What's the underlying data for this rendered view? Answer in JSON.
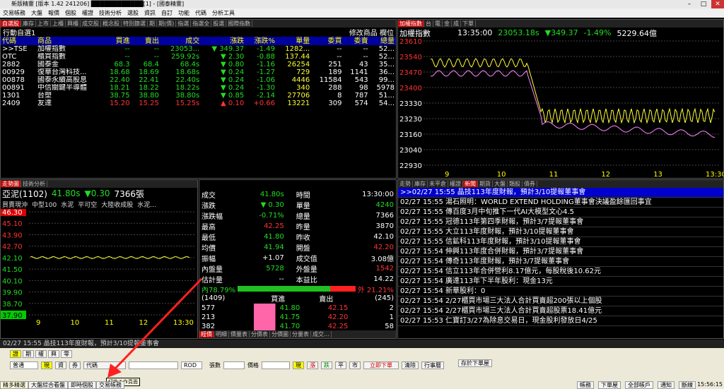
{
  "window": {
    "title": "新版精靈 [版本 1.42 241206] ████████████[1] - [國泰精靈]"
  },
  "menu": [
    "交易帳務",
    "大盤",
    "報價",
    "個股",
    "權證",
    "技術分析",
    "選股",
    "資訊",
    "自訂",
    "功能",
    "代碼",
    "分析工具"
  ],
  "watchlist": {
    "tabs": [
      "自選股",
      "庫存",
      "上市",
      "上櫃",
      "興櫃",
      "成交股",
      "概念股",
      "特別篩選",
      "期",
      "期(價)",
      "指選",
      "指選全",
      "股選",
      "國際指數"
    ],
    "active": 0,
    "name": "行動自選1",
    "right1": "修改商品",
    "right2": "欄位",
    "headers": [
      "代碼",
      "商品",
      "買進",
      "賣出",
      "成交",
      "漲跌",
      "漲跌%",
      "單量",
      "委買",
      "委賣",
      "總量"
    ],
    "rows": [
      {
        "code": ">>TSE",
        "name": "加權指數",
        "bid": "--",
        "ask": "--",
        "last": "23053...",
        "chg": "▼ 349.37",
        "pct": "-1.49",
        "vol": "1282...",
        "bq": "--",
        "aq": "--",
        "tot": "52...",
        "c": "dn"
      },
      {
        "code": "OTC",
        "name": "櫃買指數",
        "bid": "--",
        "ask": "--",
        "last": "259.92s",
        "chg": "▼ 2.30",
        "pct": "-0.88",
        "vol": "137.44",
        "bq": "--",
        "aq": "--",
        "tot": "52...",
        "c": "dn"
      },
      {
        "code": "2882",
        "name": "國泰金",
        "bid": "68.3",
        "ask": "68.4",
        "last": "68.4s",
        "chg": "▼ 0.80",
        "pct": "-1.16",
        "vol": "26254",
        "bq": "251",
        "aq": "43",
        "tot": "35...",
        "c": "dn"
      },
      {
        "code": "00929",
        "name": "復華台灣科技...",
        "bid": "18.68",
        "ask": "18.69",
        "last": "18.68s",
        "chg": "▼ 0.24",
        "pct": "-1.27",
        "vol": "729",
        "bq": "189",
        "aq": "1141",
        "tot": "36...",
        "c": "dn"
      },
      {
        "code": "00878",
        "name": "國泰永續高股息",
        "bid": "22.40",
        "ask": "22.41",
        "last": "22.40s",
        "chg": "▼ 0.24",
        "pct": "-1.06",
        "vol": "4446",
        "bq": "11584",
        "aq": "543",
        "tot": "99...",
        "c": "dn"
      },
      {
        "code": "00891",
        "name": "中信關鍵半導體",
        "bid": "18.21",
        "ask": "18.22",
        "last": "18.22s",
        "chg": "▼ 0.24",
        "pct": "-1.30",
        "vol": "340",
        "bq": "288",
        "aq": "98",
        "tot": "5978",
        "c": "dn"
      },
      {
        "code": "1301",
        "name": "台塑",
        "bid": "38.75",
        "ask": "38.80",
        "last": "38.80s",
        "chg": "▼ 0.85",
        "pct": "-2.14",
        "vol": "27706",
        "bq": "8",
        "aq": "787",
        "tot": "51...",
        "c": "dn"
      },
      {
        "code": "2409",
        "name": "友達",
        "bid": "15.20",
        "ask": "15.25",
        "last": "15.25s",
        "chg": "▲ 0.10",
        "pct": "+0.66",
        "vol": "13221",
        "bq": "309",
        "aq": "574",
        "tot": "54...",
        "c": "up"
      }
    ]
  },
  "index_chart": {
    "tabs": [
      "加權指數",
      "台",
      "電",
      "金",
      "成",
      "下單"
    ],
    "name": "加權指數",
    "time": "13:35:00",
    "value": "23053.18s",
    "chg": "▼349.37",
    "pct": "-1.49%",
    "amount": "5229.64億",
    "yticks": [
      "23610",
      "23540",
      "23470",
      "23400",
      "23330",
      "23230",
      "23160",
      "23040",
      "22930"
    ],
    "xticks": [
      "9",
      "10",
      "11",
      "12",
      "13",
      "13:30"
    ]
  },
  "stock_chart": {
    "tabs": [
      "走勢圖",
      "技術分析"
    ],
    "name": "亞泥(1102)",
    "last": "41.80s",
    "chg": "▼0.30",
    "vol": "7366張",
    "subtabs": [
      "買賣現沖",
      "中型100",
      "水泥",
      "平可空",
      "大陸收成股",
      "水泥..."
    ],
    "yticks": [
      "46.30",
      "45.10",
      "43.90",
      "42.70",
      "42.10",
      "41.50",
      "40.10",
      "39.90",
      "38.70",
      "37.90"
    ],
    "xticks": [
      "9",
      "10",
      "11",
      "12",
      "13:30"
    ]
  },
  "quote": {
    "left": [
      [
        "成交",
        "41.80s",
        "dn"
      ],
      [
        "漲跌",
        "▼ 0.30",
        "dn"
      ],
      [
        "漲跌幅",
        "-0.71%",
        "dn"
      ],
      [
        "最高",
        "42.25",
        "up"
      ],
      [
        "最低",
        "41.80",
        "dn"
      ],
      [
        "均價",
        "41.94",
        "dn"
      ],
      [
        "振幅",
        "+1.07",
        "wh"
      ],
      [
        "內盤量",
        "5728",
        "dn"
      ],
      [
        "估計量",
        "--",
        "wh"
      ]
    ],
    "right": [
      [
        "時間",
        "13:30:00",
        "wh"
      ],
      [
        "單量",
        "4240",
        "dn"
      ],
      [
        "總量",
        "7366",
        "wh"
      ],
      [
        "昨量",
        "3870",
        "wh"
      ],
      [
        "昨收",
        "42.10",
        "wh"
      ],
      [
        "開盤",
        "42.20",
        "up"
      ],
      [
        "成交值",
        "3.08億",
        "wh"
      ],
      [
        "外盤量",
        "1542",
        "up"
      ],
      [
        "本益比",
        "14.22",
        "wh"
      ]
    ],
    "inner": "內78.79%",
    "outer": "外 21.21%",
    "inner_pct": 78.79,
    "depth_head": [
      "(1409)",
      "買進",
      "賣出",
      "(245)"
    ],
    "depth": [
      [
        "577",
        "41.80",
        "42.15",
        "2"
      ],
      [
        "213",
        "41.75",
        "42.20",
        "1"
      ],
      [
        "382",
        "41.70",
        "42.25",
        "58"
      ]
    ],
    "bottom_tabs": [
      "經價",
      "明細",
      "價量表",
      "分價表",
      "分價圖",
      "分量表",
      "成交..."
    ]
  },
  "news": {
    "tabs": [
      "走勢",
      "庫存",
      "未平倉",
      "權證",
      "新聞",
      "期貨",
      "大盤",
      "類股",
      "債券"
    ],
    "items": [
      "02/27 15:55 晶技113年度財報，預計3/10提報董事會",
      "02/27 15:55 湯石照明：WORLD EXTEND HOLDING董事會決議盈餘匯回事宜",
      "02/27 15:55 傳百度3月中旬推下一代AI大模型文心4.5",
      "02/27 15:55 冠德113年第四季財報，預計3/7提報董事會",
      "02/27 15:55 大立113年度財報，預計3/10提報董事會",
      "02/27 15:55 信鉱科113年度財報，預計3/10提報董事會",
      "02/27 15:54 伸興113年度合併財報，預計3/7提報董事會",
      "02/27 15:54 傳奇113年度財報，預計3/7提報董事會",
      "02/27 15:54 信立113年合併營利8.17億元，每股稅後10.62元",
      "02/27 15:54 廣達113年下半年股利：現金13元",
      "02/27 15:54 新華股利：0",
      "02/27 15:54 2/27櫃買市場三大法人合計買賣超200張以上個股",
      "02/27 15:54 2/27櫃買市場三大法人合計買賣超股票18.41億元",
      "02/27 15:53 仁寶訂3/27為除息交易日，現金股利發放日4/25"
    ]
  },
  "ticker": "02/27 15:55 晶技113年度財報，預計3/10提報董事會",
  "order": {
    "side_tabs": [
      "證",
      "期",
      "權",
      "興",
      "零"
    ],
    "type": "普通",
    "cash": "現",
    "fin": "資",
    "sec": "券",
    "code_label": "代碼",
    "price_type": "ROD",
    "qty_label": "張數",
    "price_label": "價格",
    "ref_label": "現",
    "lim": "漲",
    "flat": "跌",
    "mid": "平",
    "market": "市",
    "submit": "立即下單",
    "clear": "清除",
    "order_tab": "行事曆",
    "keep": "存於下單屋",
    "tooltip": "切換工作頁面"
  },
  "pages": [
    "精多精選",
    "大盤綜合看盤",
    "即時個股",
    "交易帳務"
  ],
  "status": [
    "帳務",
    "下單屋",
    "全部帳戶",
    "通知",
    "斷線"
  ],
  "clock": "15:56:15"
}
